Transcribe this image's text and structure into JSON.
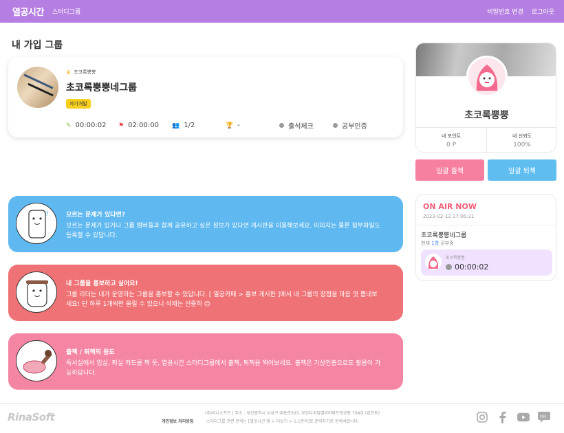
{
  "nav": {
    "logo": "열공시간",
    "study_group": "스터디그룹",
    "change_password": "비밀번호 변경",
    "logout": "로그아웃"
  },
  "page_title": "내 가입 그룹",
  "group": {
    "owner": "초코록뿡뿡",
    "name": "초코록뿡뿡네그룹",
    "tag": "자기개발",
    "study_time": "00:00:02",
    "goal_time": "02:00:00",
    "members": "1/2",
    "rank": "-",
    "attendance": "출석체크",
    "study_verify": "공부인증"
  },
  "info_cards": [
    {
      "title": "모르는 문제가 있다면?",
      "desc": "모르는 문제가 있거나 그룹 멤버들과 함께 공유하고 싶은 정보가 있다면 게시판을 이용해보세요. 이미지는 물론 첨부파일도 등록할 수 있답니다."
    },
    {
      "title": "내 그룹을 홍보하고 싶어요!",
      "desc": "그룹 리더는 내가 운영하는 그룹을 홍보할 수 있답니다. [ 열공카페 > 홍보 게시판 ]에서 내 그룹의 장점을 마음 껏 뽐내보세요! 단 하루 1개씩만 올릴 수 있으니 삭제는 신중히 😊"
    },
    {
      "title": "출첵 / 퇴첵의 용도",
      "desc": "독서실에서 입실, 퇴실 카드를 찍 듯, 열공시간 스터디그룹에서 출첵, 퇴첵을 찍어보세요. 출첵은 기상인증으로도 활용이 가능하답니다."
    }
  ],
  "profile": {
    "name": "초코록뿡뿡",
    "points_label": "내 포인트",
    "points_value": "0 P",
    "trust_label": "내 신뢰도",
    "trust_value": "100%"
  },
  "buttons": {
    "check_in": "일괄 출첵",
    "check_out": "일괄 퇴첵"
  },
  "on_air": {
    "title": "ON AIR NOW",
    "datetime": "2023-02-12 17:06:31",
    "group_name": "초코록뿡뿡네그룹",
    "count_prefix": "현재",
    "count_value": "1명",
    "count_suffix": "공부중",
    "member_name": "초코록뿡뿡",
    "member_time": "00:00:02"
  },
  "footer": {
    "logo": "RinaSoft",
    "address": "(주)리나소프트 | 주소 : 부산광역시 사상구 대동로303, 부산디지털밸리아파트형공장 708호 (감전동)",
    "policy": "개인정보 처리방침",
    "contact": "스터디그룹 관련 문의는 [열공시간 앱 > 더보기 > 1:1문의]로 문의하기로 문의바랍니다."
  },
  "colors": {
    "nav": "#b57ee2",
    "blue_card": "#5fb8ef",
    "red_card": "#ef7376",
    "pink_card": "#f586a3",
    "check_in": "#f77fa0",
    "check_out": "#5fbdf0",
    "on_air": "#f35e78"
  },
  "icons": {
    "social": [
      "instagram-icon",
      "facebook-icon",
      "youtube-icon",
      "kakao-talk-icon"
    ]
  }
}
